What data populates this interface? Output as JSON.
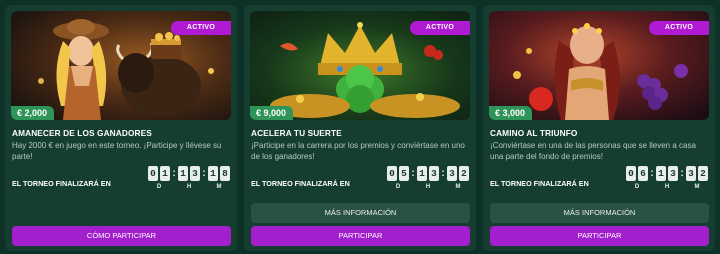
{
  "colors": {
    "page_bg": "#0d3126",
    "card_bg": "#153e31",
    "badge_bg": "#b01ad2",
    "prize_bg": "#2f9458",
    "secondary_button_bg": "#2a5243",
    "primary_button_bg": "#a11fcc",
    "timer_digit_bg": "#e8eee9"
  },
  "cards": [
    {
      "badge": "ACTIVO",
      "prize": "€ 2,000",
      "title": "AMANECER DE LOS GANADORES",
      "description": "Hay 2000 € en juego en este torneo. ¡Participe y llévese su parte!",
      "ends_label": "EL TORNEO FINALIZARÁ EN",
      "timer": {
        "d": [
          "0",
          "1"
        ],
        "h": [
          "1",
          "3"
        ],
        "m": [
          "1",
          "8"
        ]
      },
      "timer_labels": {
        "d": "D",
        "h": "H",
        "m": "M"
      },
      "primary_button": "CÓMO PARTICIPAR",
      "image_icon": "cowgirl-bison-treasure-illustration"
    },
    {
      "badge": "ACTIVO",
      "prize": "€ 9,000",
      "title": "ACELERA TU SUERTE",
      "description": "¡Participe en la carrera por los premios y conviértase en uno de los ganadores!",
      "ends_label": "EL TORNEO FINALIZARÁ EN",
      "timer": {
        "d": [
          "0",
          "5"
        ],
        "h": [
          "1",
          "3"
        ],
        "m": [
          "3",
          "2"
        ]
      },
      "timer_labels": {
        "d": "D",
        "h": "H",
        "m": "M"
      },
      "secondary_button": "MÁS INFORMACIÓN",
      "primary_button": "PARTICIPAR",
      "image_icon": "golden-crown-clover-illustration"
    },
    {
      "badge": "ACTIVO",
      "prize": "€ 3,000",
      "title": "CAMINO AL TRIUNFO",
      "description": "¡Conviértase en una de las personas que se lleven a casa una parte del fondo de premios!",
      "ends_label": "EL TORNEO FINALIZARÁ EN",
      "timer": {
        "d": [
          "0",
          "6"
        ],
        "h": [
          "1",
          "3"
        ],
        "m": [
          "3",
          "2"
        ]
      },
      "timer_labels": {
        "d": "D",
        "h": "H",
        "m": "M"
      },
      "secondary_button": "MÁS INFORMACIÓN",
      "primary_button": "PARTICIPAR",
      "image_icon": "fruit-goddess-illustration"
    }
  ]
}
